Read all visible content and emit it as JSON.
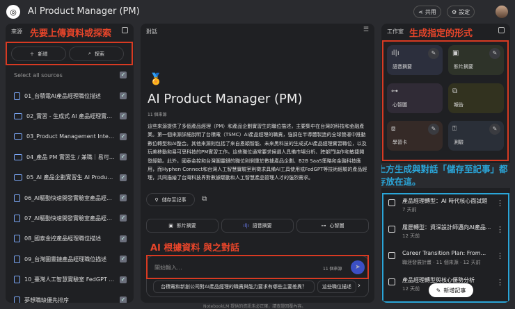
{
  "app": {
    "title": "AI Product Manager (PM)",
    "share": "共用",
    "settings": "設定"
  },
  "sources": {
    "header": "來源",
    "add": "新增",
    "discover": "探索",
    "select_all": "Select all sources",
    "items": [
      "01_台積電AI產品經理職位描述",
      "02_實習 - 生成式 AI 產品經理實習...",
      "03_Product Management Intern ...",
      "04_產品 PM 實習生 / 兼職｜易可思...",
      "05_AI 產品企劃實習生 AI Product I...",
      "06_AI驅動快速開發實驗室產品經...",
      "07_AI驅動快速開發實驗室產品經理...",
      "08_國泰金控產品經理職位描述",
      "09_台灣圖靈鏈產品經理職位描述",
      "10_臺灣人工智慧實驗室 FedGPT ...",
      "夢想職缺優先排序"
    ]
  },
  "chat": {
    "header": "對話",
    "title": "AI Product Manager (PM)",
    "source_count": "11 個來源",
    "summary": "這些來源提供了多個產品經理（PM）和產品企劃實習生的職位描述，主要集中在台灣的科技和金融產業。第一個來源詳細說明了台積電（TSMC）AI產品經理的職責，強調在半導體製造的全球營運中推動數位轉型和AI整合。其他來源則包括了來自恩穎智能、未來黑科技的生成式AI產品經理實習職位，以及玩美移動和易可思科技的PM實習工作。這些職位通常要求候選人具備市場分析、跨部門協作和敏捷開發經驗。此外，國泰金控和台灣圖靈鏈的職位則側重於數據產品企劃、B2B SaaS策略和金融科技應用，而Hyphen Connect和台灣人工智慧實驗室則徵求具備AI工具使用或FedGPT等技術經驗的產品經理，共同描繪了台灣科技界對數據驅動和人工智慧產品管理人才的強烈需求。",
    "save_note": "儲存至記事",
    "quick": [
      "影片摘要",
      "語音摘要",
      "心智圖"
    ],
    "input_placeholder": "開始輸入...",
    "input_count": "11 個來源",
    "suggestions": [
      "台積電和新創公司對AI產品經理的職責與能力要求有哪些主要差異？",
      "這些職位描述"
    ],
    "footer": "NotebookLM 提供的資訊未必正確，請查證回覆內容。"
  },
  "studio": {
    "header": "工作室",
    "cards": [
      "語音摘要",
      "影片摘要",
      "心智圖",
      "報告",
      "學習卡",
      "測驗"
    ],
    "notes": [
      {
        "title": "產品經理轉型：AI 時代核心面試題",
        "sub": "7 天前"
      },
      {
        "title": "履歷轉型：資深設計師邁向AI產品...",
        "sub": "12 天前"
      },
      {
        "title": "Career Transition Plan: From...",
        "sub": "職涯發展計畫 · 11 個來源 · 12 天前"
      },
      {
        "title": "產品經理轉型與核心優勢分析",
        "sub": "12 天前"
      }
    ],
    "add_note": "新增記事"
  },
  "annotations": {
    "sources": "先要上傳資料或探索",
    "studio": "生成指定的形式",
    "chat": "AI 根據資料 與之對話",
    "notes": "上方生成與對話「儲存至記事」都存放在這。"
  },
  "colors": {
    "red": "#e8452a",
    "blue": "#2aa5d8",
    "send": "#3b4fc4"
  }
}
